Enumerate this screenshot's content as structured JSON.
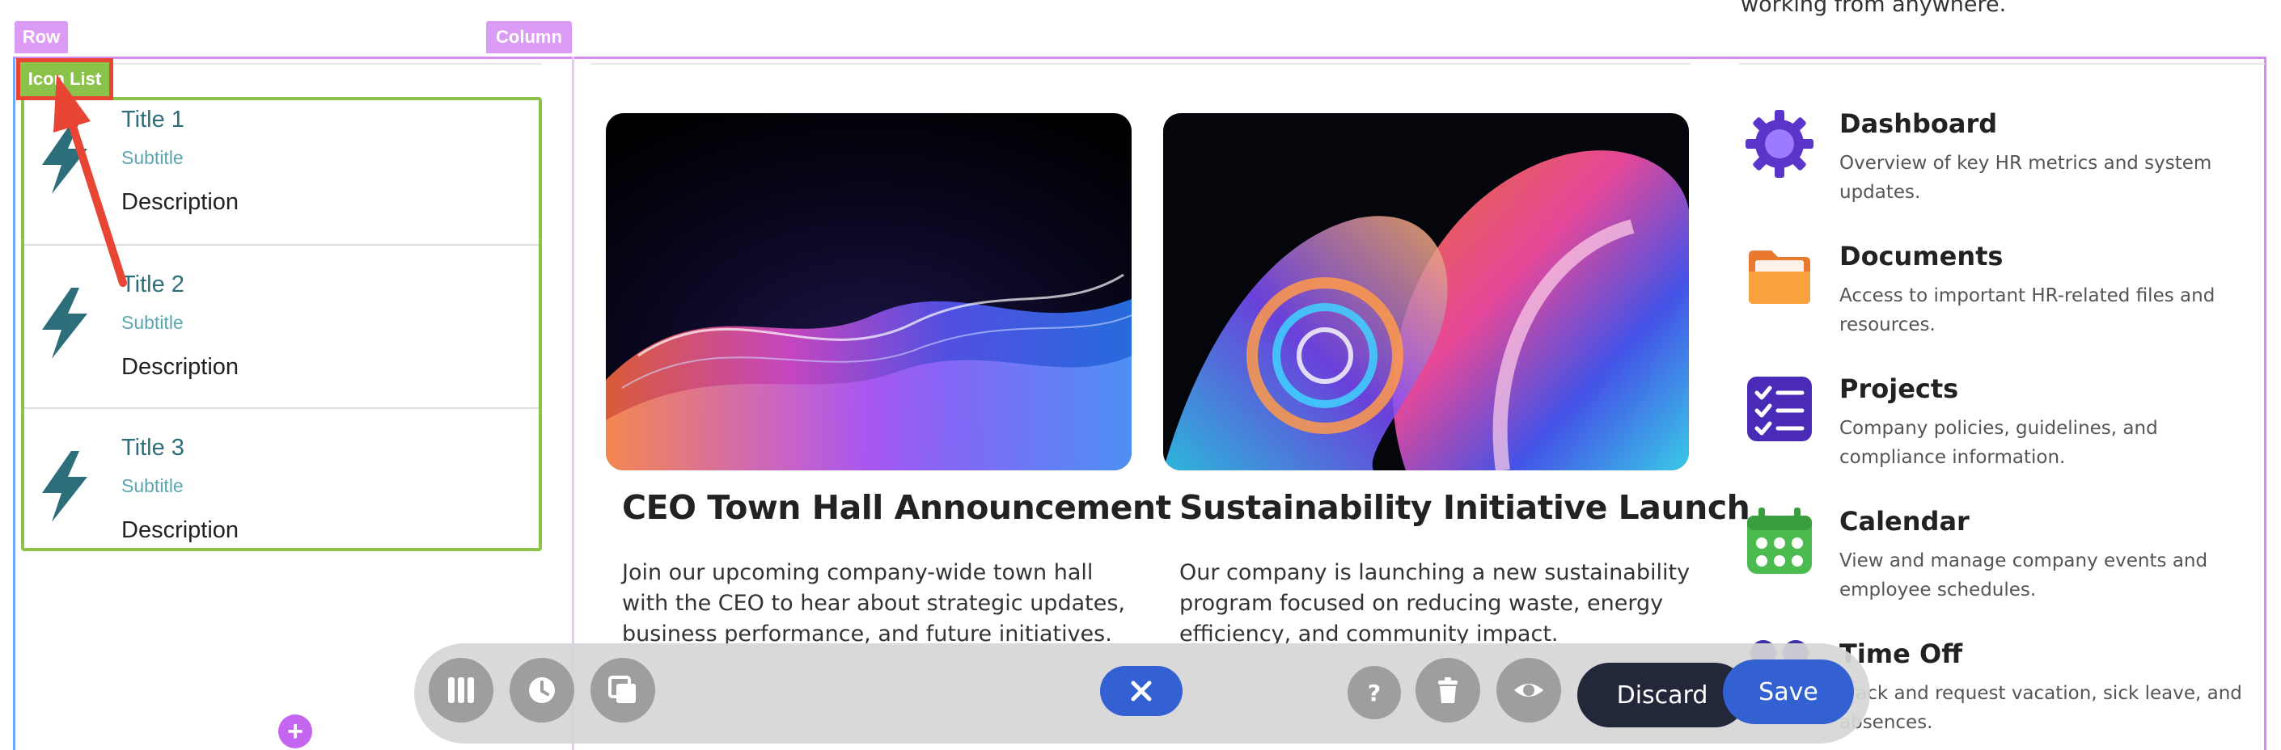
{
  "editor": {
    "row_tag": "Row",
    "column_tag": "Column",
    "widget_tag": "Icon List"
  },
  "top_snippet": "working from anywhere.",
  "icon_list": {
    "items": [
      {
        "title": "Title 1",
        "subtitle": "Subtitle",
        "description": "Description",
        "icon": "lightning-bolt-icon"
      },
      {
        "title": "Title 2",
        "subtitle": "Subtitle",
        "description": "Description",
        "icon": "lightning-bolt-icon"
      },
      {
        "title": "Title 3",
        "subtitle": "Subtitle",
        "description": "Description",
        "icon": "lightning-bolt-icon"
      }
    ]
  },
  "cards": [
    {
      "title": "CEO Town Hall Announcement",
      "text": "Join our upcoming company-wide town hall with the CEO to hear about strategic updates, business performance, and future initiatives.",
      "image": "abstract-wave-image"
    },
    {
      "title": "Sustainability Initiative Launch",
      "text": "Our company is launching a new sustainability program focused on reducing waste, energy efficiency, and community impact.",
      "image": "abstract-swirl-image"
    }
  ],
  "nav_list": [
    {
      "title": "Dashboard",
      "description": "Overview of key HR metrics and system updates.",
      "icon": "gear-icon"
    },
    {
      "title": "Documents",
      "description": "Access to important HR-related files and resources.",
      "icon": "folder-icon"
    },
    {
      "title": "Projects",
      "description": "Company policies, guidelines, and compliance information.",
      "icon": "checklist-icon"
    },
    {
      "title": "Calendar",
      "description": "View and manage company events and employee schedules.",
      "icon": "calendar-icon"
    },
    {
      "title": "Time Off",
      "description": "Track and request vacation, sick leave, and absences.",
      "icon": "people-icon"
    }
  ],
  "toolbar": {
    "buttons_left": [
      "columns-icon",
      "history-icon",
      "duplicate-icon"
    ],
    "close": "close-icon",
    "buttons_right": [
      "help-icon",
      "trash-icon",
      "preview-eye-icon"
    ],
    "discard_label": "Discard",
    "save_label": "Save"
  },
  "colors": {
    "row_outline": "#d58cf0",
    "widget_outline": "#8bc34a",
    "annotation": "#e84535",
    "primary": "#3361d1",
    "dark": "#23273a",
    "teal": "#2c6e79"
  }
}
